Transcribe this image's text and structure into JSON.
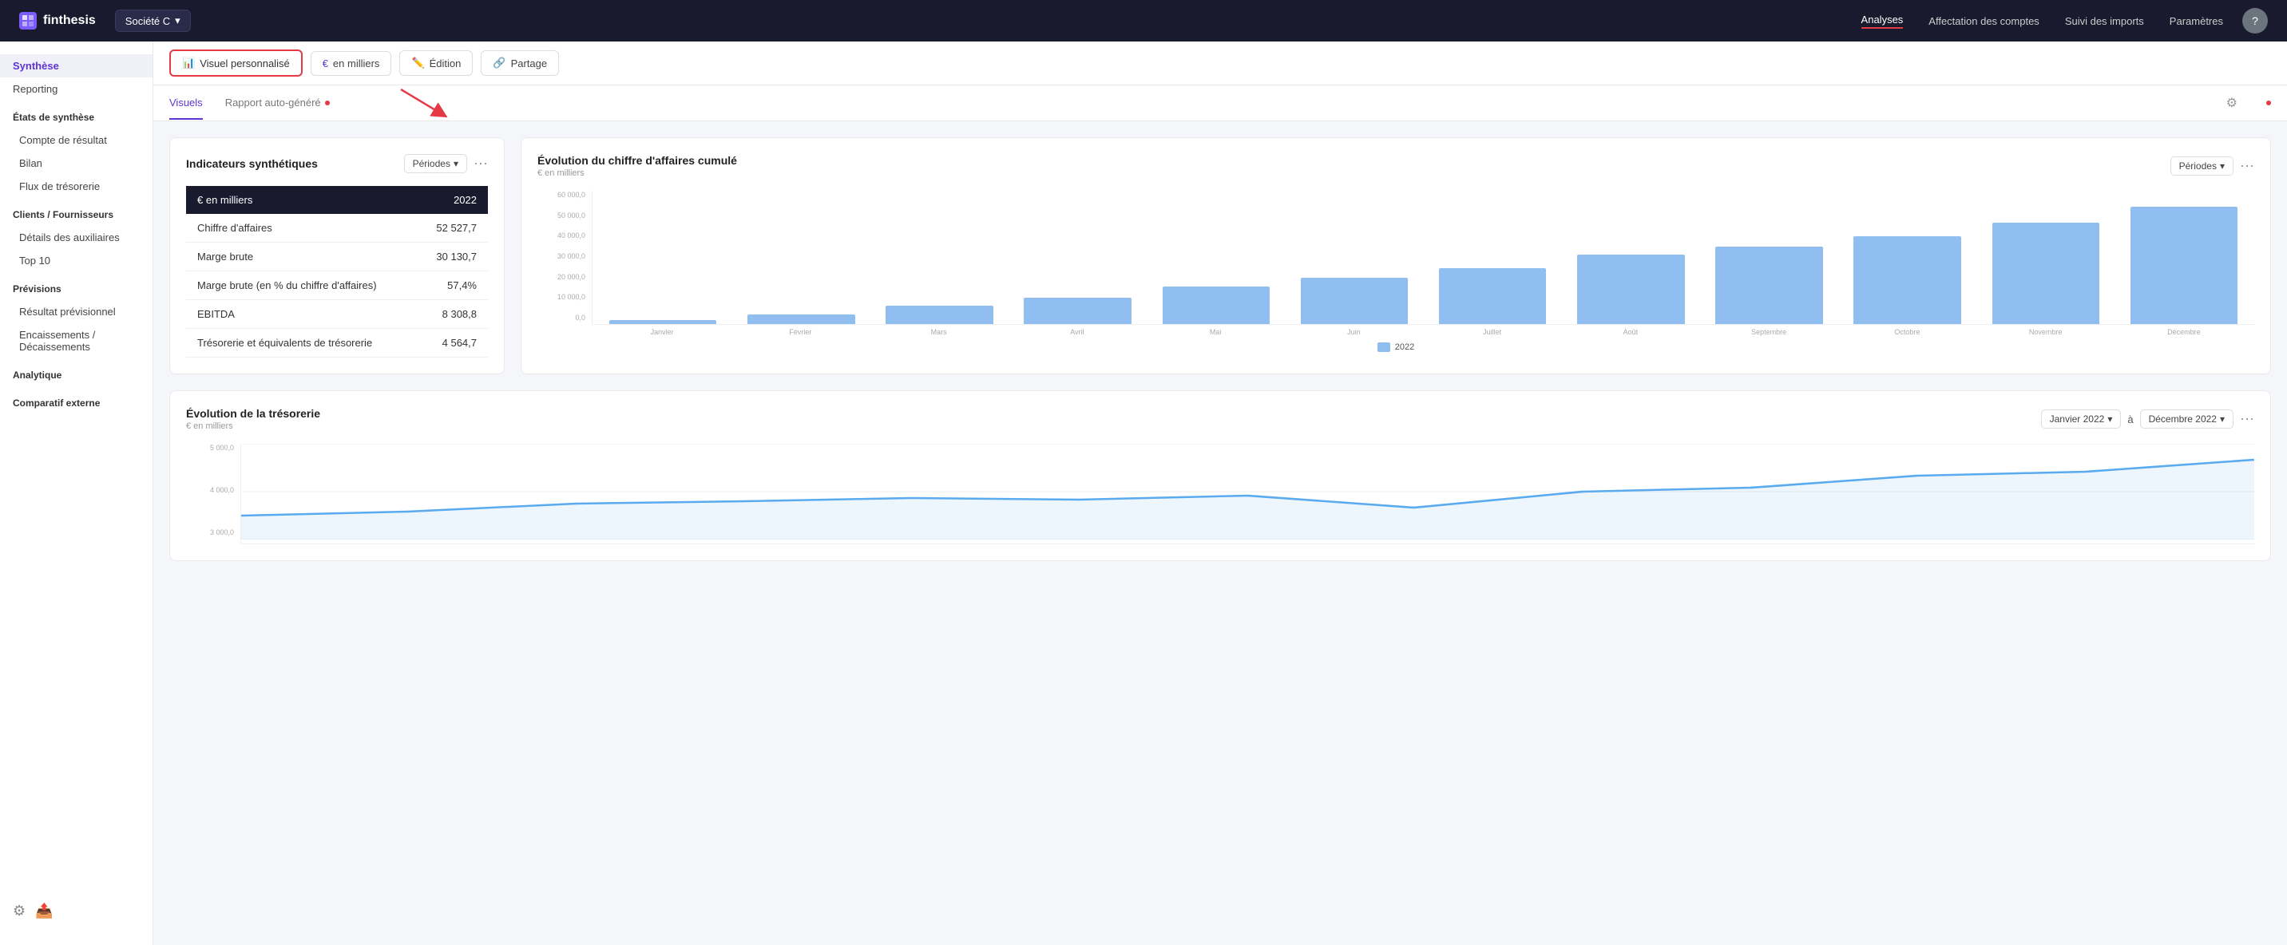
{
  "app": {
    "logo_text": "finthesis",
    "company_label": "Société C",
    "nav_links": [
      "Analyses",
      "Affectation des comptes",
      "Suivi des imports",
      "Paramètres"
    ],
    "nav_active": "Analyses"
  },
  "sidebar": {
    "synthese_label": "Synthèse",
    "reporting_label": "Reporting",
    "etats_label": "États de synthèse",
    "compte_label": "Compte de résultat",
    "bilan_label": "Bilan",
    "flux_label": "Flux de trésorerie",
    "clients_label": "Clients / Fournisseurs",
    "details_label": "Détails des auxiliaires",
    "top10_label": "Top 10",
    "previsions_label": "Prévisions",
    "resultat_label": "Résultat prévisionnel",
    "encaissements_label": "Encaissements / Décaissements",
    "analytique_label": "Analytique",
    "comparatif_label": "Comparatif externe"
  },
  "toolbar": {
    "visuel_label": "Visuel personnalisé",
    "milliers_label": "en milliers",
    "edition_label": "Édition",
    "partage_label": "Partage"
  },
  "tabs": {
    "visuels_label": "Visuels",
    "rapport_label": "Rapport auto-généré"
  },
  "indicators": {
    "card_title": "Indicateurs synthétiques",
    "period_label": "Périodes",
    "header_currency": "€ en milliers",
    "header_year": "2022",
    "rows": [
      {
        "label": "Chiffre d'affaires",
        "value": "52 527,7"
      },
      {
        "label": "Marge brute",
        "value": "30 130,7"
      },
      {
        "label": "Marge brute (en % du chiffre d'affaires)",
        "value": "57,4%"
      },
      {
        "label": "EBITDA",
        "value": "8 308,8"
      },
      {
        "label": "Trésorerie et équivalents de trésorerie",
        "value": "4 564,7"
      }
    ]
  },
  "evolution_ca": {
    "card_title": "Évolution du chiffre d'affaires cumulé",
    "subtitle": "€ en milliers",
    "period_label": "Périodes",
    "legend_label": "2022",
    "y_labels": [
      "60 000,0",
      "50 000,0",
      "40 000,0",
      "30 000,0",
      "20 000,0",
      "10 000,0",
      "0,0"
    ],
    "bars": [
      {
        "month": "Janvier",
        "height_pct": 3
      },
      {
        "month": "Février",
        "height_pct": 7
      },
      {
        "month": "Mars",
        "height_pct": 14
      },
      {
        "month": "Avril",
        "height_pct": 20
      },
      {
        "month": "Mai",
        "height_pct": 28
      },
      {
        "month": "Juin",
        "height_pct": 35
      },
      {
        "month": "Juillet",
        "height_pct": 42
      },
      {
        "month": "Août",
        "height_pct": 52
      },
      {
        "month": "Septembre",
        "height_pct": 58
      },
      {
        "month": "Octobre",
        "height_pct": 66
      },
      {
        "month": "Novembre",
        "height_pct": 76
      },
      {
        "month": "Décembre",
        "height_pct": 88
      }
    ]
  },
  "evolution_treso": {
    "card_title": "Évolution de la trésorerie",
    "subtitle": "€ en milliers",
    "from_label": "Janvier 2022",
    "to_label": "à",
    "to_end_label": "Décembre 2022",
    "y_labels": [
      "5 000,0",
      "4 000,0",
      "3 000,0"
    ]
  }
}
